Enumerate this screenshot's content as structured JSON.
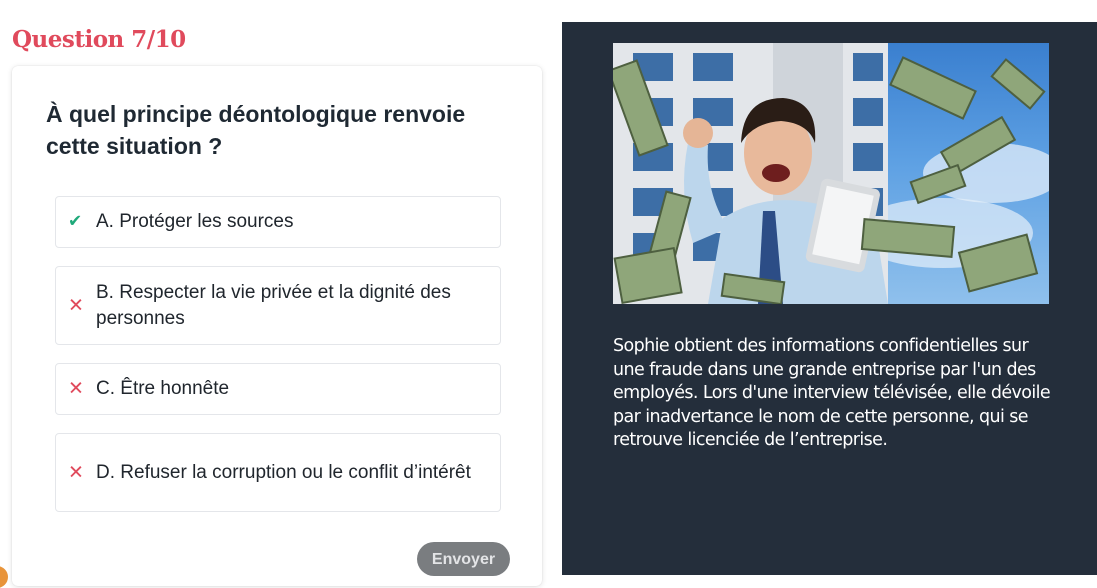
{
  "quiz": {
    "counter": "Question 7/10",
    "question": "À quel principe déontologique renvoie cette situation ?",
    "answers": [
      {
        "label": "A. Protéger les sources",
        "status": "correct",
        "icon": "check-icon"
      },
      {
        "label": "B. Respecter la vie privée et la dignité des personnes",
        "status": "wrong",
        "icon": "cross-icon"
      },
      {
        "label": "C. Être honnête",
        "status": "wrong",
        "icon": "cross-icon"
      },
      {
        "label": "D. Refuser la corruption ou le conflit d’intérêt",
        "status": "wrong",
        "icon": "cross-icon"
      }
    ],
    "submit_label": "Envoyer"
  },
  "context": {
    "image_alt": "man-celebrating-with-tablet-and-flying-banknotes",
    "scenario": "Sophie obtient des informations confidentielles sur une fraude dans une grande entreprise par l'un des employés. Lors d'une interview télévisée, elle dévoile par inadvertance le nom de cette personne, qui se retrouve licenciée de l’entreprise."
  },
  "colors": {
    "accent": "#e04a5c",
    "correct": "#1fa97a",
    "panel_bg": "#242e3b",
    "button_bg": "#7a7d80"
  }
}
